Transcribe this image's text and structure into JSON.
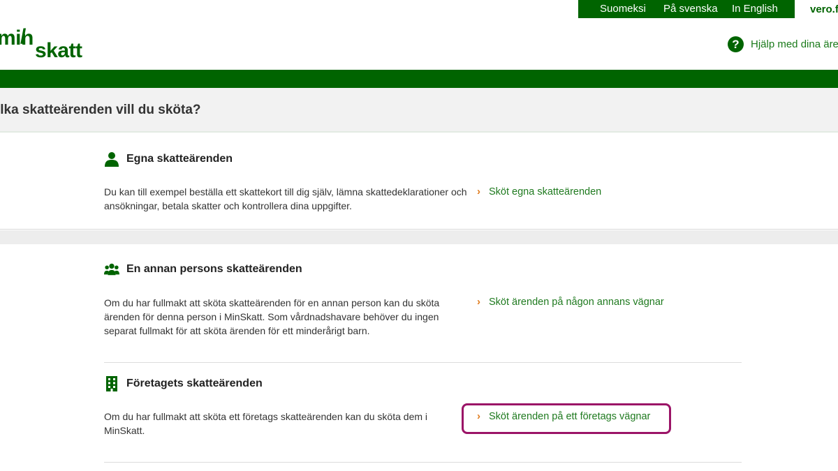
{
  "header": {
    "languages": [
      "Suomeksi",
      "På svenska",
      "In English"
    ],
    "site_link": "vero.fi",
    "logo": {
      "part1": "min",
      "slash": "/",
      "part2": "skatt"
    },
    "help_label": "Hjälp med dina ären"
  },
  "question": "ilka skatteärenden vill du sköta?",
  "sections": [
    {
      "icon": "person-icon",
      "title": "Egna skatteärenden",
      "description": "Du kan till exempel beställa ett skattekort till dig själv, lämna skattedeklarationer och ansökningar, betala skatter och kontrollera dina uppgifter.",
      "action": "Sköt egna skatteärenden"
    },
    {
      "icon": "people-icon",
      "title": "En annan persons skatteärenden",
      "description": "Om du har fullmakt att sköta skatteärenden för en annan person kan du sköta ärenden för denna person i MinSkatt. Som vårdnadshavare behöver du ingen separat fullmakt för att sköta ärenden för ett minderårigt barn.",
      "action": "Sköt ärenden på någon annans vägnar"
    },
    {
      "icon": "building-icon",
      "title": "Företagets skatteärenden",
      "description": "Om du har fullmakt att sköta ett företags skatteärenden kan du sköta dem i MinSkatt.",
      "action": "Sköt ärenden på ett företags vägnar"
    }
  ],
  "chevron": "›",
  "colors": {
    "brand_green": "#006400",
    "link_green": "#1f7a1f",
    "chevron_orange": "#e07b1d",
    "highlight_magenta": "#9b1467"
  }
}
